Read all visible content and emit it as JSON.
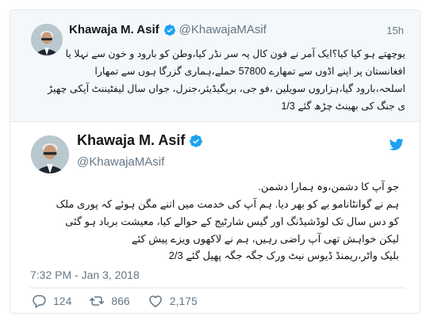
{
  "parent_tweet": {
    "display_name": "Khawaja M. Asif",
    "handle": "@KhawajaMAsif",
    "timestamp": "15h",
    "lines": [
      "یوچھتے ہو کیا کیا؟ایک آمر نے فون کال پہ سر نڈر کیا،وطن کو بارود و خون سے نہلا یا",
      "افغانستان پر اپنے اڈوں سے تمھارے 57800 حملے،ہماری گزرگا ہوں سے تمھارا",
      "اسلحہ،بارود گیا،ہزاروں سویلین ،فو جی، بریگیڈیئر،جنرل، جواں سال لیفٹیننٹ آپکی چھیڑ",
      "ی جنگ کی بھینٹ چڑھ گئے 1/3"
    ]
  },
  "main_tweet": {
    "display_name": "Khawaja M. Asif",
    "handle": "@KhawajaMAsif",
    "lines": [
      "جو آپ کا دشمن،وہ ہمارا دشمن.",
      "ہم نے گوانٹانامو بے کو بھر دیا. ہم آپ کی خدمت میں اتنے مگن ہوئے کہ پوری ملک",
      "کو دس سال تک لوڈشیڈنگ اور گیس شارٹیج کے حوالے کیا، معیشت برباد ہو گئی",
      "لیکن خواہش تھی آپ راضی رہیں، ہم نے لاکھوں ویزے پیش کئے",
      "بلیک واٹر،ریمنڈ ڈیوس نیٹ ورک جگہ جگہ پھیل گئے 2/3"
    ],
    "datetime": "7:32 PM - Jan 3, 2018",
    "replies": "124",
    "retweets": "866",
    "likes": "2,175"
  },
  "icons": {
    "verified": "verified-badge-icon",
    "brand": "twitter-bird-icon",
    "reply": "reply-icon",
    "retweet": "retweet-icon",
    "like": "heart-icon"
  },
  "colors": {
    "brand_blue": "#1da1f2",
    "muted_text": "#657786",
    "parent_background": "#f5f8fa"
  }
}
